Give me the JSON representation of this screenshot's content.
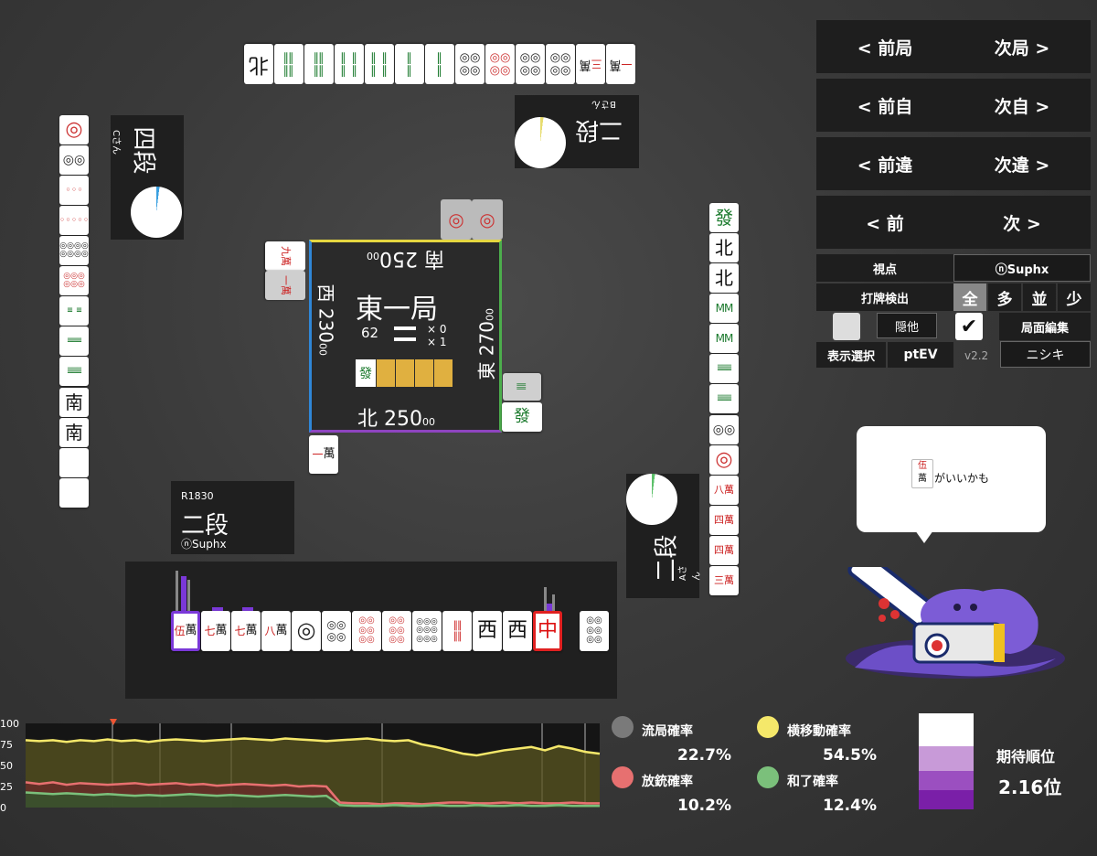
{
  "nav": {
    "prev_round": "< 前局",
    "next_round": "次局 >",
    "prev_self": "< 前自",
    "next_self": "次自 >",
    "prev_diff": "< 前違",
    "next_diff": "次違 >",
    "prev": "< 前",
    "next": "次 >"
  },
  "controls": {
    "viewpoint_label": "視点",
    "viewpoint_value": "ⓝSuphx",
    "detect_label": "打牌検出",
    "detect_options": [
      "全",
      "多",
      "並",
      "少"
    ],
    "others_label": "隠他",
    "edit_label": "局面編集",
    "display_label": "表示選択",
    "display_value": "ptEV",
    "version": "v2.2",
    "character": "ニシキ"
  },
  "center": {
    "round": "東一局",
    "tiles_left": "62",
    "honba": "× 0",
    "riichi": "× 1",
    "south_label": "南",
    "south_score": "250",
    "south_small": "00",
    "west_label": "西",
    "west_score": "230",
    "west_small": "00",
    "east_label": "東",
    "east_score": "270",
    "east_small": "00",
    "north_label": "北",
    "north_score": "250",
    "north_small": "00"
  },
  "players": {
    "top": {
      "rank": "二段",
      "name": "Bさん"
    },
    "left": {
      "rank": "四段",
      "name": "Cさん"
    },
    "right": {
      "rank": "二段",
      "name": "Aさん"
    },
    "self": {
      "rating": "R1830",
      "rank": "二段",
      "name": "ⓝSuphx"
    }
  },
  "bubble": {
    "tile_top": "伍",
    "tile_bottom": "萬",
    "text": "がいいかも"
  },
  "stats": {
    "ryukyoku_label": "流局確率",
    "ryukyoku_value": "22.7%",
    "yoko_label": "横移動確率",
    "yoko_value": "54.5%",
    "houju_label": "放銃確率",
    "houju_value": "10.2%",
    "agari_label": "和了確率",
    "agari_value": "12.4%",
    "expected_label": "期待順位",
    "expected_value": "2.16位",
    "color_ryukyoku": "#7a7a7a",
    "color_yoko": "#f5e86a",
    "color_houju": "#e77070",
    "color_agari": "#7bc07b"
  },
  "chart_data": {
    "type": "area",
    "ylim": [
      0,
      100
    ],
    "yticks": [
      "100",
      "75",
      "50",
      "25",
      "0"
    ],
    "series": [
      {
        "values": [
          80,
          79,
          80,
          78,
          80,
          79,
          81,
          79,
          80,
          78,
          80,
          81,
          80,
          79,
          80,
          81,
          82,
          81,
          80,
          82,
          81,
          80,
          79,
          80,
          81,
          82,
          80,
          79,
          80,
          75,
          72,
          68,
          64,
          62,
          65,
          68,
          70,
          72,
          68,
          73,
          70,
          66,
          64
        ]
      },
      {
        "values": [
          30,
          28,
          30,
          27,
          29,
          28,
          27,
          28,
          29,
          27,
          28,
          29,
          27,
          28,
          26,
          27,
          28,
          27,
          26,
          27,
          25,
          26,
          25,
          6,
          5,
          5,
          4,
          5,
          5,
          4,
          5,
          6,
          6,
          5,
          5,
          6,
          5,
          6,
          5,
          5,
          6,
          5,
          5
        ]
      },
      {
        "values": [
          18,
          17,
          16,
          17,
          16,
          15,
          16,
          15,
          14,
          15,
          14,
          15,
          16,
          15,
          14,
          15,
          14,
          13,
          14,
          15,
          14,
          13,
          14,
          3,
          2,
          2,
          2,
          3,
          2,
          2,
          3,
          2,
          2,
          3,
          2,
          2,
          3,
          2,
          2,
          3,
          2,
          2,
          2
        ]
      }
    ]
  }
}
